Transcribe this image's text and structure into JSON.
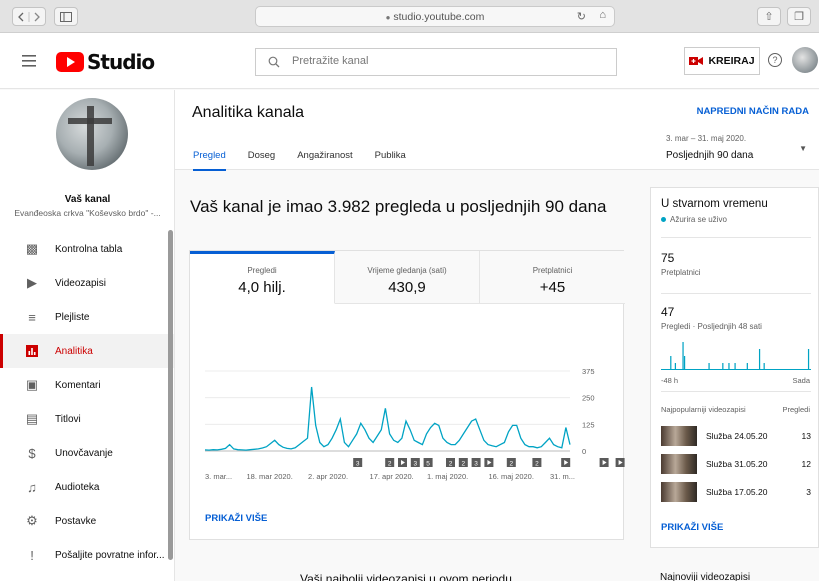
{
  "browser": {
    "url": "studio.youtube.com",
    "lock": "lock-icon"
  },
  "header": {
    "logo_text": "Studio",
    "search_placeholder": "Pretražite kanal",
    "create_label": "KREIRAJ",
    "help_icon": "?"
  },
  "sidebar": {
    "channel_title": "Vaš kanal",
    "channel_name": "Evanđeoska crkva \"Koševsko brdo\" -...",
    "items": [
      {
        "label": "Kontrolna tabla",
        "icon": "dashboard-icon"
      },
      {
        "label": "Videozapisi",
        "icon": "video-icon"
      },
      {
        "label": "Plejliste",
        "icon": "playlist-icon"
      },
      {
        "label": "Analitika",
        "icon": "analytics-icon",
        "active": true
      },
      {
        "label": "Komentari",
        "icon": "comments-icon"
      },
      {
        "label": "Titlovi",
        "icon": "subtitles-icon"
      },
      {
        "label": "Unovčavanje",
        "icon": "dollar-icon"
      },
      {
        "label": "Audioteka",
        "icon": "audio-library-icon"
      },
      {
        "label": "Postavke",
        "icon": "gear-icon"
      },
      {
        "label": "Pošaljite povratne infor...",
        "icon": "feedback-icon"
      }
    ]
  },
  "page": {
    "title": "Analitika kanala",
    "advanced_mode": "NAPREDNI NAČIN RADA",
    "tabs": [
      "Pregled",
      "Doseg",
      "Angažiranost",
      "Publika"
    ],
    "active_tab": "Pregled",
    "date_range": "3. mar – 31. maj 2020.",
    "date_label": "Posljednjih 90 dana"
  },
  "main": {
    "headline": "Vaš kanal je imao 3.982 pregleda u posljednjih 90 dana",
    "metrics": [
      {
        "label": "Pregledi",
        "value": "4,0 hilj."
      },
      {
        "label": "Vrijeme gledanja (sati)",
        "value": "430,9"
      },
      {
        "label": "Pretplatnici",
        "value": "+45"
      }
    ],
    "show_more": "PRIKAŽI VIŠE",
    "best_videos_heading": "Vaši najbolji videozapisi u ovom periodu"
  },
  "chart_data": {
    "type": "line",
    "y_ticks": [
      "375",
      "250",
      "125",
      "0"
    ],
    "ylim": [
      0,
      375
    ],
    "x_labels": [
      "3. mar...",
      "18. mar 2020.",
      "2. apr 2020.",
      "17. apr 2020.",
      "1. maj 2020.",
      "16. maj 2020.",
      "31. m..."
    ],
    "x_label_days": [
      0,
      15,
      30,
      45,
      59,
      74,
      89
    ],
    "values": [
      5,
      4,
      6,
      5,
      8,
      12,
      30,
      10,
      6,
      5,
      4,
      6,
      8,
      10,
      14,
      20,
      35,
      50,
      30,
      18,
      12,
      10,
      15,
      30,
      45,
      60,
      300,
      120,
      40,
      20,
      30,
      60,
      100,
      150,
      40,
      20,
      50,
      80,
      130,
      100,
      60,
      40,
      70,
      100,
      200,
      80,
      50,
      40,
      60,
      140,
      100,
      50,
      40,
      30,
      80,
      110,
      130,
      120,
      60,
      40,
      30,
      30,
      50,
      80,
      110,
      140,
      150,
      100,
      50,
      30,
      25,
      20,
      30,
      40,
      90,
      120,
      120,
      60,
      30,
      20,
      20,
      15,
      20,
      40,
      60,
      30,
      20,
      15,
      110,
      30
    ],
    "markers": [
      {
        "day": 26,
        "type": "number",
        "label": "3"
      },
      {
        "day": 36,
        "type": "number",
        "label": "2"
      },
      {
        "day": 40,
        "type": "play"
      },
      {
        "day": 44,
        "type": "number",
        "label": "3"
      },
      {
        "day": 48,
        "type": "number",
        "label": "5"
      },
      {
        "day": 55,
        "type": "number",
        "label": "2"
      },
      {
        "day": 59,
        "type": "number",
        "label": "2"
      },
      {
        "day": 63,
        "type": "number",
        "label": "3"
      },
      {
        "day": 67,
        "type": "play"
      },
      {
        "day": 74,
        "type": "number",
        "label": "2"
      },
      {
        "day": 82,
        "type": "number",
        "label": "2"
      },
      {
        "day": 91,
        "type": "play"
      },
      {
        "day": 103,
        "type": "play"
      },
      {
        "day": 108,
        "type": "play"
      }
    ],
    "color": "#00a3c4"
  },
  "realtime": {
    "title": "U stvarnom vremenu",
    "live_note": "Ažurira se uživo",
    "subscribers_value": "75",
    "subscribers_label": "Pretplatnici",
    "views_value": "47",
    "views_label": "Pregledi · Posljednjih 48 sati",
    "axis_start": "-48 h",
    "axis_end": "Sada",
    "bars": [
      0,
      0,
      0,
      0,
      0,
      0,
      2,
      0,
      0,
      1,
      0,
      0,
      0,
      0,
      4,
      2,
      0,
      0,
      0,
      0,
      0,
      0,
      0,
      0,
      0,
      0,
      0,
      0,
      0,
      0,
      0,
      1,
      0,
      0,
      0,
      0,
      0,
      0,
      0,
      0,
      1,
      0,
      0,
      0,
      1,
      0,
      0,
      0,
      1,
      0,
      0,
      0,
      0,
      0,
      0,
      0,
      1,
      0,
      0,
      0,
      0,
      0,
      0,
      0,
      3,
      0,
      0,
      1,
      0,
      0,
      0,
      0,
      0,
      0,
      0,
      0,
      0,
      0,
      0,
      0,
      0,
      0,
      0,
      0,
      0,
      0,
      0,
      0,
      0,
      0,
      0,
      0,
      0,
      0,
      0,
      0,
      3,
      0
    ],
    "top_videos_label": "Najpopularniji videozapisi",
    "views_col_label": "Pregledi",
    "top_videos": [
      {
        "title": "Služba 24.05.20",
        "views": "13"
      },
      {
        "title": "Služba 31.05.20",
        "views": "12"
      },
      {
        "title": "Služba 17.05.20",
        "views": "3"
      }
    ],
    "show_more": "PRIKAŽI VIŠE",
    "latest_heading": "Najnoviji videozapisi"
  }
}
